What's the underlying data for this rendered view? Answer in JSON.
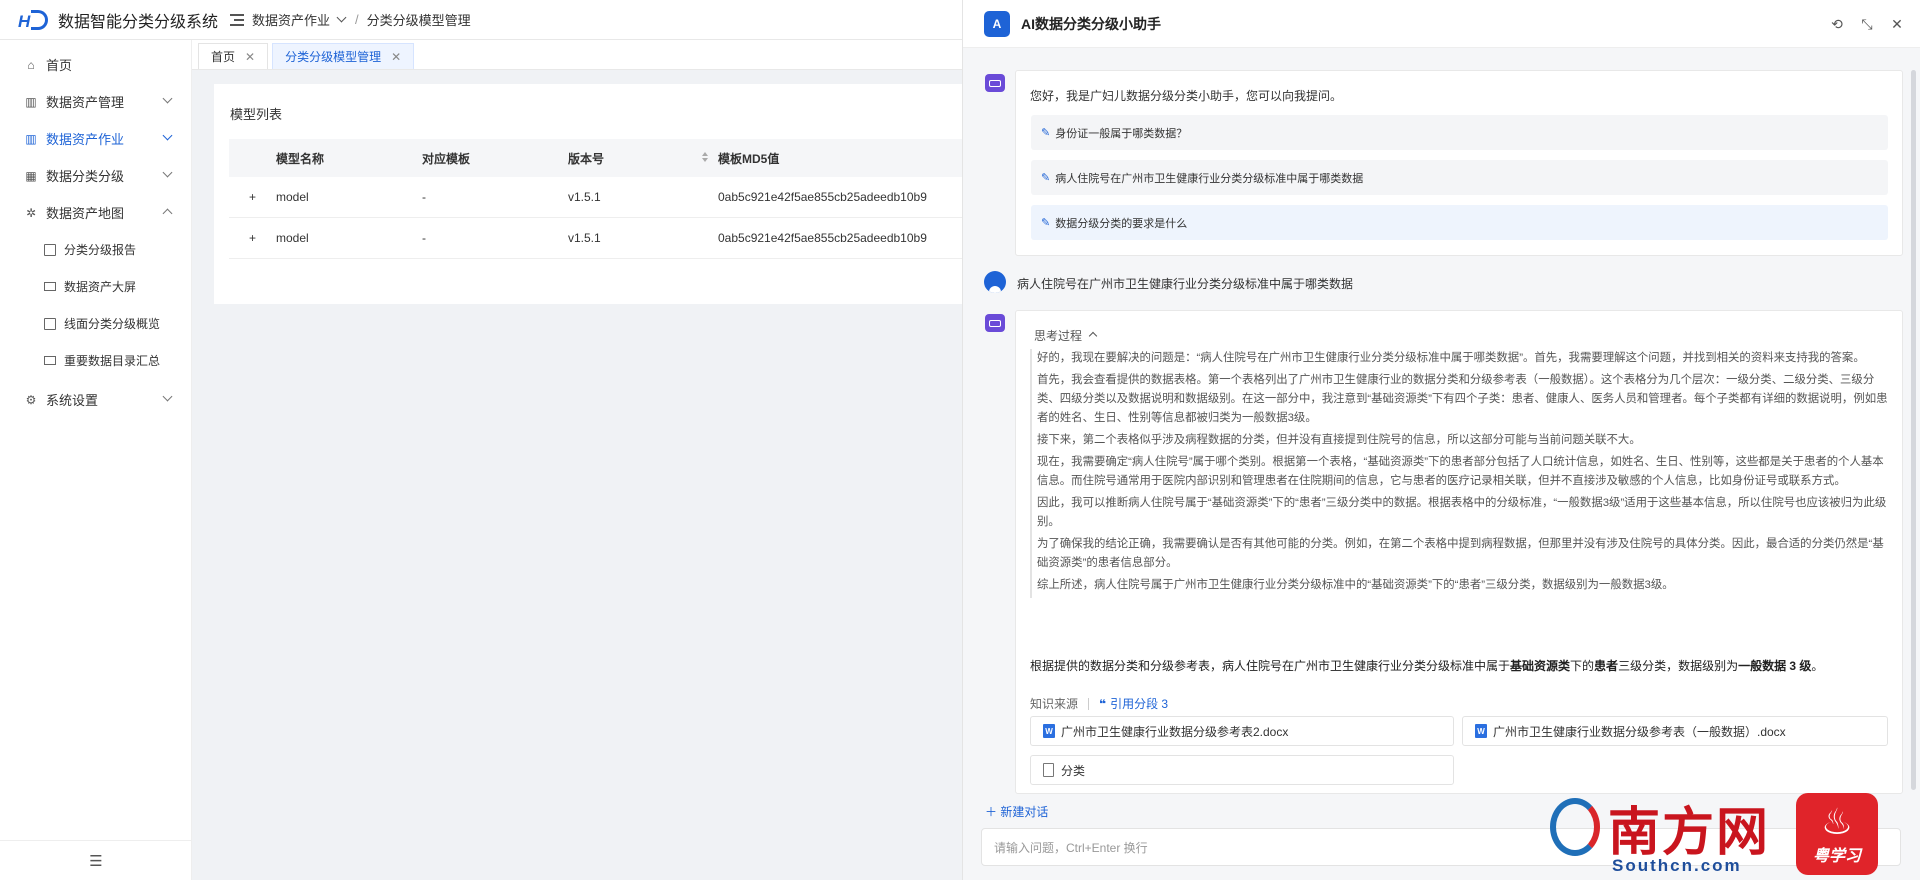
{
  "header": {
    "app_title": "数据智能分类分级系统",
    "breadcrumb": [
      "数据资产作业",
      "/",
      "分类分级模型管理"
    ]
  },
  "sidebar": {
    "items": [
      {
        "label": "首页",
        "icon": "home-icon"
      },
      {
        "label": "数据资产管理",
        "icon": "chart-icon"
      },
      {
        "label": "数据资产作业",
        "icon": "chart-icon",
        "active": true
      },
      {
        "label": "数据分类分级",
        "icon": "grid-icon"
      },
      {
        "label": "数据资产地图",
        "icon": "network-icon",
        "expanded": true
      }
    ],
    "sub_items": [
      {
        "label": "分类分级报告"
      },
      {
        "label": "数据资产大屏"
      },
      {
        "label": "线面分类分级概览"
      },
      {
        "label": "重要数据目录汇总"
      }
    ],
    "settings": {
      "label": "系统设置"
    }
  },
  "tabs": [
    {
      "label": "首页"
    },
    {
      "label": "分类分级模型管理",
      "active": true
    }
  ],
  "model_list": {
    "title": "模型列表",
    "columns": [
      "模型名称",
      "对应模板",
      "版本号",
      "模板MD5值"
    ],
    "rows": [
      {
        "expand": "+",
        "name": "model",
        "template": "-",
        "version": "v1.5.1",
        "md5": "0ab5c921e42f5ae855cb25adeedb10b9"
      },
      {
        "expand": "+",
        "name": "model",
        "template": "-",
        "version": "v1.5.1",
        "md5": "0ab5c921e42f5ae855cb25adeedb10b9"
      }
    ]
  },
  "assistant": {
    "avatar_letter": "A",
    "title": "AI数据分类分级小助手",
    "greeting": "您好，我是广妇儿数据分级分类小助手，您可以向我提问。",
    "suggestions": [
      "身份证一般属于哪类数据？",
      "病人住院号在广州市卫生健康行业分类分级标准中属于哪类数据",
      "数据分级分类的要求是什么"
    ],
    "user_question": "病人住院号在广州市卫生健康行业分类分级标准中属于哪类数据",
    "thinking_title": "思考过程",
    "thinking": [
      "好的，我现在要解决的问题是：“病人住院号在广州市卫生健康行业分类分级标准中属于哪类数据”。首先，我需要理解这个问题，并找到相关的资料来支持我的答案。",
      "首先，我会查看提供的数据表格。第一个表格列出了广州市卫生健康行业的数据分类和分级参考表（一般数据）。这个表格分为几个层次：一级分类、二级分类、三级分类、四级分类以及数据说明和数据级别。在这一部分中，我注意到“基础资源类”下有四个子类：患者、健康人、医务人员和管理者。每个子类都有详细的数据说明，例如患者的姓名、生日、性别等信息都被归类为一般数据3级。",
      "接下来，第二个表格似乎涉及病程数据的分类，但并没有直接提到住院号的信息，所以这部分可能与当前问题关联不大。",
      "现在，我需要确定“病人住院号”属于哪个类别。根据第一个表格，“基础资源类”下的患者部分包括了人口统计信息，如姓名、生日、性别等，这些都是关于患者的个人基本信息。而住院号通常用于医院内部识别和管理患者在住院期间的信息，它与患者的医疗记录相关联，但并不直接涉及敏感的个人信息，比如身份证号或联系方式。",
      "因此，我可以推断病人住院号属于“基础资源类”下的“患者”三级分类中的数据。根据表格中的分级标准，“一般数据3级”适用于这些基本信息，所以住院号也应该被归为此级别。",
      "为了确保我的结论正确，我需要确认是否有其他可能的分类。例如，在第二个表格中提到病程数据，但那里并没有涉及住院号的具体分类。因此，最合适的分类仍然是“基础资源类”的患者信息部分。",
      "综上所述，病人住院号属于广州市卫生健康行业分类分级标准中的“基础资源类”下的“患者”三级分类，数据级别为一般数据3级。"
    ],
    "answer": {
      "prefix": "根据提供的数据分类和分级参考表，病人住院号在广州市卫生健康行业分类分级标准中属于",
      "b1": "基础资源类",
      "mid1": "下的",
      "b2": "患者",
      "mid2": "三级分类，数据级别为",
      "b3": "一般数据 3 级",
      "suffix": "。"
    },
    "source_label": "知识来源",
    "cite_label": "引用分段 3",
    "documents": [
      {
        "name": "广州市卫生健康行业数据分级参考表2.docx",
        "type": "word"
      },
      {
        "name": "广州市卫生健康行业数据分级参考表（一般数据）.docx",
        "type": "word"
      },
      {
        "name": "分类",
        "type": "file"
      }
    ],
    "new_chat": "新建对话",
    "input_placeholder": "请输入问题，Ctrl+Enter 换行"
  },
  "watermark": {
    "name": "南方网",
    "url": "Southcn.com",
    "badge_text": "粤学习"
  },
  "colors": {
    "accent": "#1e63d6",
    "bot": "#6a4bd8",
    "watermark_red": "#c9151e"
  }
}
